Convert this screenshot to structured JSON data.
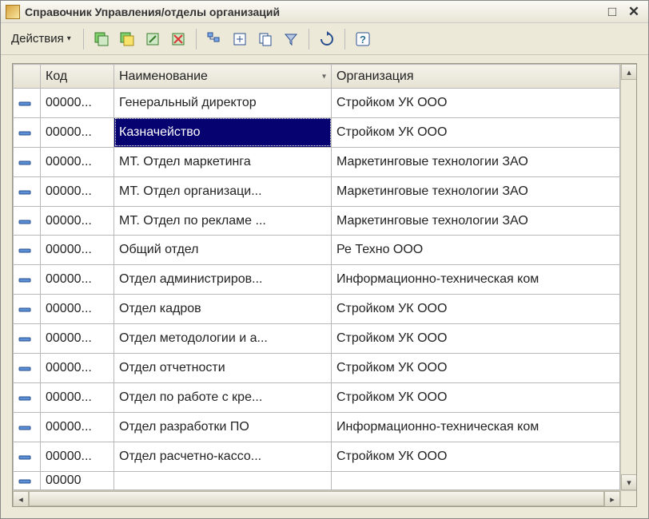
{
  "window": {
    "title": "Справочник Управления/отделы организаций"
  },
  "toolbar": {
    "actions_label": "Действия"
  },
  "columns": {
    "code": "Код",
    "name": "Наименование",
    "org": "Организация"
  },
  "selected_row_index": 1,
  "rows": [
    {
      "code": "00000...",
      "name": "Генеральный директор",
      "org": "Стройком УК ООО"
    },
    {
      "code": "00000...",
      "name": "Казначейство",
      "org": "Стройком УК ООО"
    },
    {
      "code": "00000...",
      "name": "МТ. Отдел маркетинга",
      "org": "Маркетинговые технологии ЗАО"
    },
    {
      "code": "00000...",
      "name": "МТ. Отдел организаци...",
      "org": "Маркетинговые технологии ЗАО"
    },
    {
      "code": "00000...",
      "name": "МТ. Отдел по рекламе ...",
      "org": "Маркетинговые технологии ЗАО"
    },
    {
      "code": "00000...",
      "name": "Общий отдел",
      "org": "Ре Техно ООО"
    },
    {
      "code": "00000...",
      "name": "Отдел администриров...",
      "org": "Информационно-техническая ком"
    },
    {
      "code": "00000...",
      "name": "Отдел кадров",
      "org": "Стройком УК ООО"
    },
    {
      "code": "00000...",
      "name": "Отдел методологии и а...",
      "org": "Стройком УК ООО"
    },
    {
      "code": "00000...",
      "name": "Отдел отчетности",
      "org": "Стройком УК ООО"
    },
    {
      "code": "00000...",
      "name": "Отдел по работе с кре...",
      "org": "Стройком УК ООО"
    },
    {
      "code": "00000...",
      "name": "Отдел разработки ПО",
      "org": "Информационно-техническая ком"
    },
    {
      "code": "00000...",
      "name": "Отдел расчетно-кассо...",
      "org": "Стройком УК ООО"
    },
    {
      "code": "00000",
      "name": "",
      "org": ""
    }
  ]
}
